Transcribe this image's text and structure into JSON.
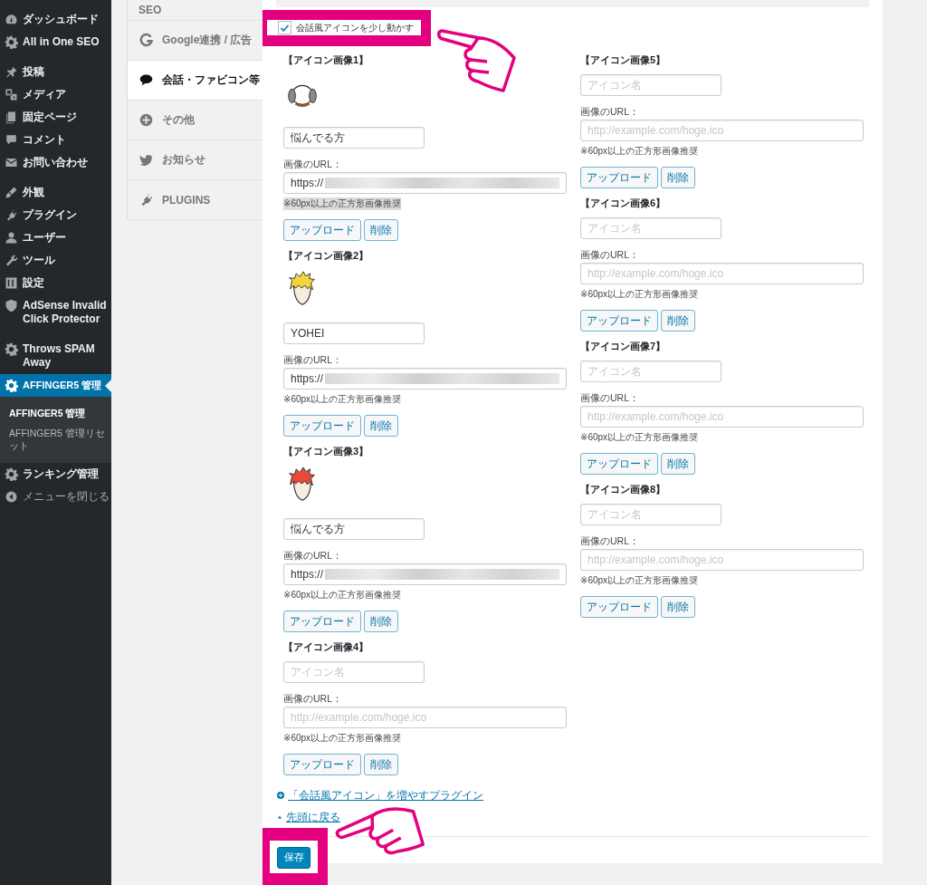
{
  "sidebar": {
    "groups": [
      {
        "items": [
          {
            "label": "ダッシュボード",
            "kind": "menu",
            "selected": false
          },
          {
            "label": "All in One SEO",
            "kind": "menu",
            "selected": false
          }
        ]
      },
      {
        "items": [
          {
            "label": "投稿",
            "kind": "menu",
            "selected": false
          },
          {
            "label": "メディア",
            "kind": "menu",
            "selected": false
          },
          {
            "label": "固定ページ",
            "kind": "menu",
            "selected": false
          },
          {
            "label": "コメント",
            "kind": "menu",
            "selected": false
          },
          {
            "label": "お問い合わせ",
            "kind": "menu",
            "selected": false
          }
        ]
      },
      {
        "items": [
          {
            "label": "外観",
            "kind": "menu",
            "selected": false
          },
          {
            "label": "プラグイン",
            "kind": "menu",
            "selected": false
          },
          {
            "label": "ユーザー",
            "kind": "menu",
            "selected": false
          },
          {
            "label": "ツール",
            "kind": "menu",
            "selected": false
          },
          {
            "label": "設定",
            "kind": "menu",
            "selected": false
          },
          {
            "label": "AdSense Invalid Click Protector",
            "kind": "menu",
            "selected": false
          }
        ]
      },
      {
        "items": [
          {
            "label": "Throws SPAM Away",
            "kind": "menu",
            "selected": false
          },
          {
            "label": "AFFINGER5 管理",
            "kind": "menu",
            "selected": true,
            "submenu": [
              {
                "label": "AFFINGER5 管理",
                "selected": true
              },
              {
                "label": "AFFINGER5 管理リセット",
                "selected": false
              }
            ]
          },
          {
            "label": "ランキング管理",
            "kind": "menu",
            "selected": false
          },
          {
            "label": "メニューを閉じる",
            "kind": "collapse",
            "selected": false
          }
        ]
      }
    ]
  },
  "settings_tabs": [
    {
      "label": "SEO",
      "selected": false
    },
    {
      "label": "Google連携 / 広告",
      "selected": false
    },
    {
      "label": "会話・ファビコン等",
      "selected": true
    },
    {
      "label": "その他",
      "selected": false
    },
    {
      "label": "お知らせ",
      "selected": false
    },
    {
      "label": "PLUGINS",
      "selected": false
    }
  ],
  "option": {
    "label": "会話風アイコンを少し動かす",
    "checked": true
  },
  "columns": [
    {
      "items": [
        {
          "heading": "【アイコン画像1】",
          "name": {
            "value": "悩んでる方"
          },
          "url_label": "画像のURL：",
          "url": {
            "value": "https://",
            "redacted": true
          },
          "note": "※60px以上の正方形画像推奨",
          "note_highlighted": true,
          "buttons": [
            "アップロード",
            "削除"
          ]
        },
        {
          "heading": "【アイコン画像2】",
          "name": {
            "value": "YOHEI"
          },
          "url_label": "画像のURL：",
          "url": {
            "value": "https://",
            "redacted": true
          },
          "note": "※60px以上の正方形画像推奨",
          "note_highlighted": false,
          "buttons": [
            "アップロード",
            "削除"
          ]
        },
        {
          "heading": "【アイコン画像3】",
          "name": {
            "value": "悩んでる方"
          },
          "url_label": "画像のURL：",
          "url": {
            "value": "https://",
            "redacted": true
          },
          "note": "※60px以上の正方形画像推奨",
          "note_highlighted": false,
          "buttons": [
            "アップロード",
            "削除"
          ]
        },
        {
          "heading": "【アイコン画像4】",
          "name": {
            "placeholder": "アイコン名"
          },
          "url_label": "画像のURL：",
          "url": {
            "placeholder": "http://example.com/hoge.ico",
            "redacted": false
          },
          "note": "※60px以上の正方形画像推奨",
          "note_highlighted": false,
          "buttons": [
            "アップロード",
            "削除"
          ]
        }
      ]
    },
    {
      "items": [
        {
          "heading": "【アイコン画像5】",
          "name": {
            "placeholder": "アイコン名"
          },
          "url_label": "画像のURL：",
          "url": {
            "placeholder": "http://example.com/hoge.ico",
            "redacted": false
          },
          "note": "※60px以上の正方形画像推奨",
          "note_highlighted": false,
          "buttons": [
            "アップロード",
            "削除"
          ]
        },
        {
          "heading": "【アイコン画像6】",
          "name": {
            "placeholder": "アイコン名"
          },
          "url_label": "画像のURL：",
          "url": {
            "placeholder": "http://example.com/hoge.ico",
            "redacted": false
          },
          "note": "※60px以上の正方形画像推奨",
          "note_highlighted": false,
          "buttons": [
            "アップロード",
            "削除"
          ]
        },
        {
          "heading": "【アイコン画像7】",
          "name": {
            "placeholder": "アイコン名"
          },
          "url_label": "画像のURL：",
          "url": {
            "placeholder": "http://example.com/hoge.ico",
            "redacted": false
          },
          "note": "※60px以上の正方形画像推奨",
          "note_highlighted": false,
          "buttons": [
            "アップロード",
            "削除"
          ]
        },
        {
          "heading": "【アイコン画像8】",
          "name": {
            "placeholder": "アイコン名"
          },
          "url_label": "画像のURL：",
          "url": {
            "placeholder": "http://example.com/hoge.ico",
            "redacted": false
          },
          "note": "※60px以上の正方形画像推奨",
          "note_highlighted": false,
          "buttons": [
            "アップロード",
            "削除"
          ]
        }
      ]
    }
  ],
  "links": [
    {
      "kind": "plugin",
      "label": "「会話風アイコン」を増やすプラグイン"
    },
    {
      "kind": "top",
      "label": "先頭に戻る"
    }
  ],
  "save_button": "保存"
}
